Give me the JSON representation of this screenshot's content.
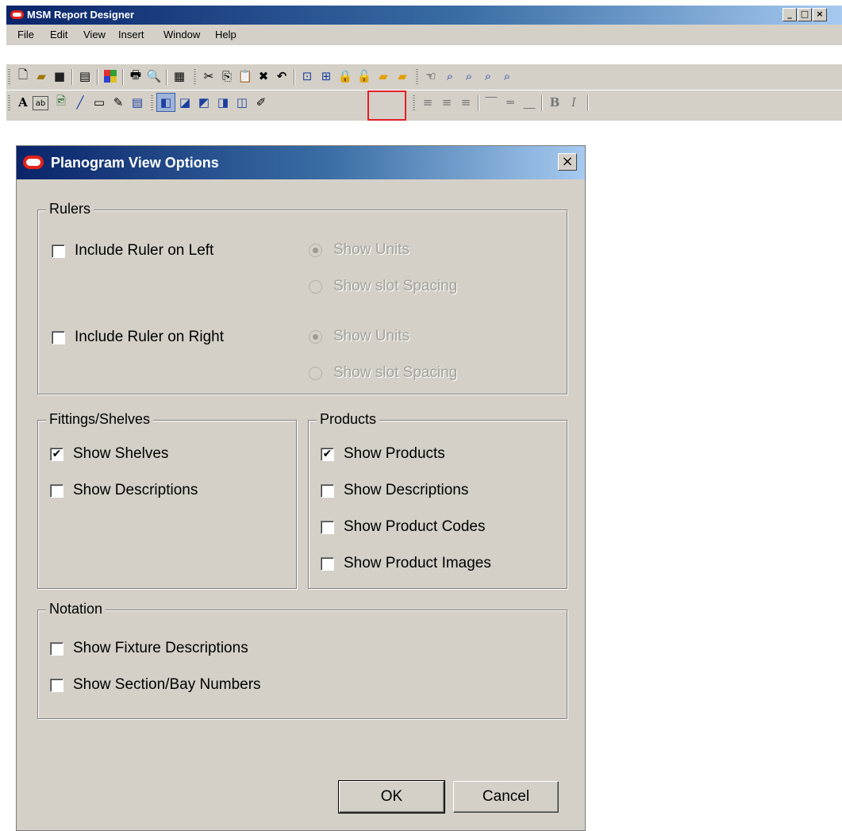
{
  "app": {
    "title": "MSM Report Designer",
    "window_buttons": [
      "_",
      "□",
      "×"
    ],
    "menu": [
      "File",
      "Edit",
      "View",
      "Insert",
      "Window",
      "Help"
    ],
    "toolbar1_icons": [
      "new-icon",
      "open-icon",
      "save-icon",
      "properties-icon",
      "color-palette-icon",
      "print-icon",
      "print-preview-icon",
      "report-icon",
      "cut-icon",
      "copy-icon",
      "paste-icon",
      "delete-icon",
      "undo-icon",
      "fit-page-icon",
      "fit-width-icon",
      "lock-icon",
      "unlock-icon",
      "bring-forward-icon",
      "send-backward-icon",
      "pan-icon",
      "zoom-icon",
      "zoom-in-icon",
      "zoom-out-icon",
      "zoom-fit-icon"
    ],
    "toolbar2_icons": [
      "text-icon",
      "field-icon",
      "image-icon",
      "line-icon",
      "rectangle-icon",
      "pen-icon",
      "table-icon",
      "planogram-front-icon",
      "planogram-3d-icon",
      "planogram-side-icon",
      "planogram-angle-icon",
      "planogram-top-icon",
      "planogram-view-options-icon",
      "align-left-icon",
      "align-center-icon",
      "align-right-icon",
      "valign-top-icon",
      "valign-middle-icon",
      "valign-bottom-icon",
      "bold-icon",
      "italic-icon"
    ],
    "text_glyphs": {
      "text": "A",
      "field": "ab",
      "bold": "B",
      "italic": "I"
    },
    "highlight_color": "#e0202a"
  },
  "dialog": {
    "title": "Planogram View Options",
    "close_label": "×",
    "rulers": {
      "title": "Rulers",
      "left": {
        "label": "Include Ruler on Left",
        "checked": false,
        "opt_units": "Show Units",
        "opt_spacing": "Show slot Spacing"
      },
      "right": {
        "label": "Include Ruler on Right",
        "checked": false,
        "opt_units": "Show Units",
        "opt_spacing": "Show slot Spacing"
      }
    },
    "fittings": {
      "title": "Fittings/Shelves",
      "show_shelves": {
        "label": "Show Shelves",
        "checked": true
      },
      "show_descriptions": {
        "label": "Show Descriptions",
        "checked": false
      }
    },
    "products": {
      "title": "Products",
      "show_products": {
        "label": "Show Products",
        "checked": true
      },
      "show_descriptions": {
        "label": "Show Descriptions",
        "checked": false
      },
      "show_codes": {
        "label": "Show Product Codes",
        "checked": false
      },
      "show_images": {
        "label": "Show Product Images",
        "checked": false
      }
    },
    "notation": {
      "title": "Notation",
      "fixture_desc": {
        "label": "Show Fixture Descriptions",
        "checked": false
      },
      "section_bay": {
        "label": "Show Section/Bay Numbers",
        "checked": false
      }
    },
    "ok_label": "OK",
    "cancel_label": "Cancel",
    "check_mark": "✔"
  }
}
